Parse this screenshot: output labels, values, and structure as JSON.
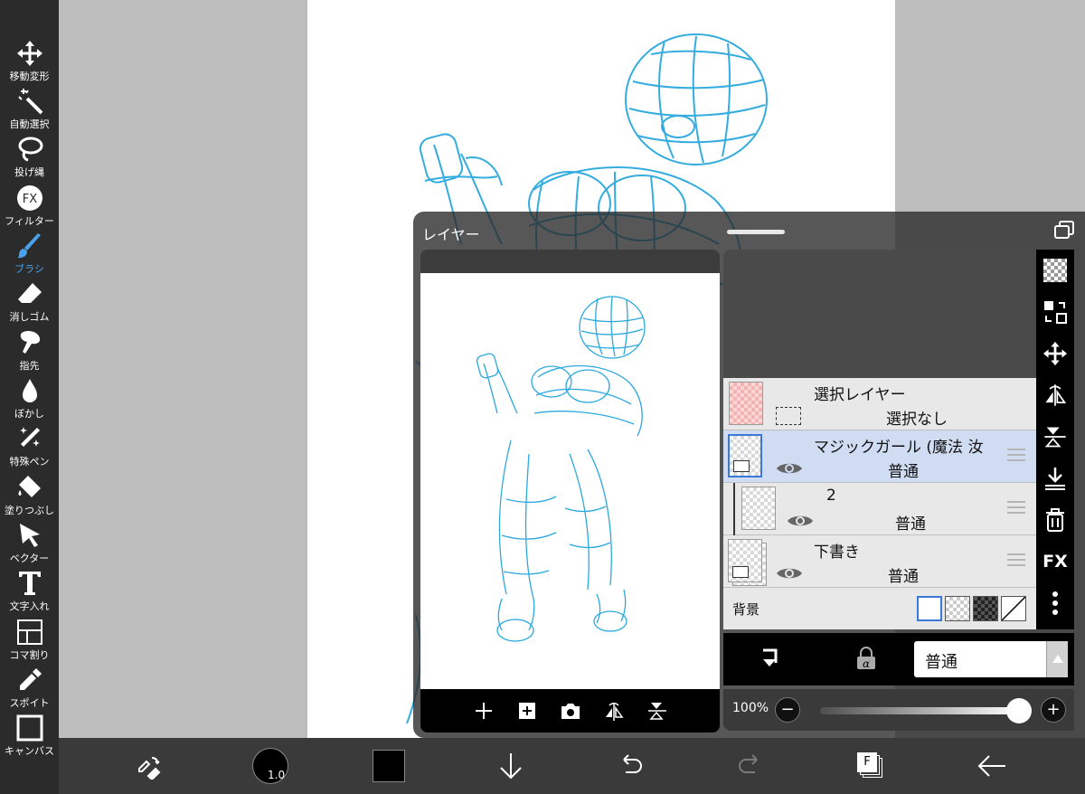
{
  "toolbar": {
    "tools": [
      {
        "label": "移動変形",
        "icon": "move-icon"
      },
      {
        "label": "自動選択",
        "icon": "magic-wand-icon"
      },
      {
        "label": "投げ縄",
        "icon": "lasso-icon"
      },
      {
        "label": "フィルター",
        "icon": "fx-icon"
      },
      {
        "label": "ブラシ",
        "icon": "brush-icon",
        "active": true
      },
      {
        "label": "消しゴム",
        "icon": "eraser-icon"
      },
      {
        "label": "指先",
        "icon": "finger-icon"
      },
      {
        "label": "ぼかし",
        "icon": "blur-icon"
      },
      {
        "label": "特殊ペン",
        "icon": "special-pen-icon"
      },
      {
        "label": "塗りつぶし",
        "icon": "fill-icon"
      },
      {
        "label": "ベクター",
        "icon": "vector-icon"
      },
      {
        "label": "文字入れ",
        "icon": "text-icon"
      },
      {
        "label": "コマ割り",
        "icon": "frame-divider-icon"
      },
      {
        "label": "スポイト",
        "icon": "eyedropper-icon"
      },
      {
        "label": "キャンバス",
        "icon": "canvas-icon"
      }
    ],
    "active_color": "#4aa3ee"
  },
  "bottombar": {
    "brush_size": "1.0",
    "current_color": "#000000",
    "material_label": "F"
  },
  "layer_panel": {
    "title": "レイヤー",
    "layers": [
      {
        "name": "選択レイヤー",
        "sub": "選択なし",
        "type": "selection"
      },
      {
        "name": "マジックガール (魔法 汝",
        "blend": "普通",
        "type": "folder",
        "selected": true
      },
      {
        "name": "2",
        "blend": "普通",
        "type": "layer"
      },
      {
        "name": "下書き",
        "blend": "普通",
        "type": "folder"
      }
    ],
    "background_label": "背景",
    "blend_mode": "普通",
    "opacity": "100%",
    "opacity_value": 1.0,
    "opacity_minus": "−",
    "opacity_plus": "+",
    "side_fx_label": "FX",
    "selected_row_color": "#cfdcf2"
  }
}
